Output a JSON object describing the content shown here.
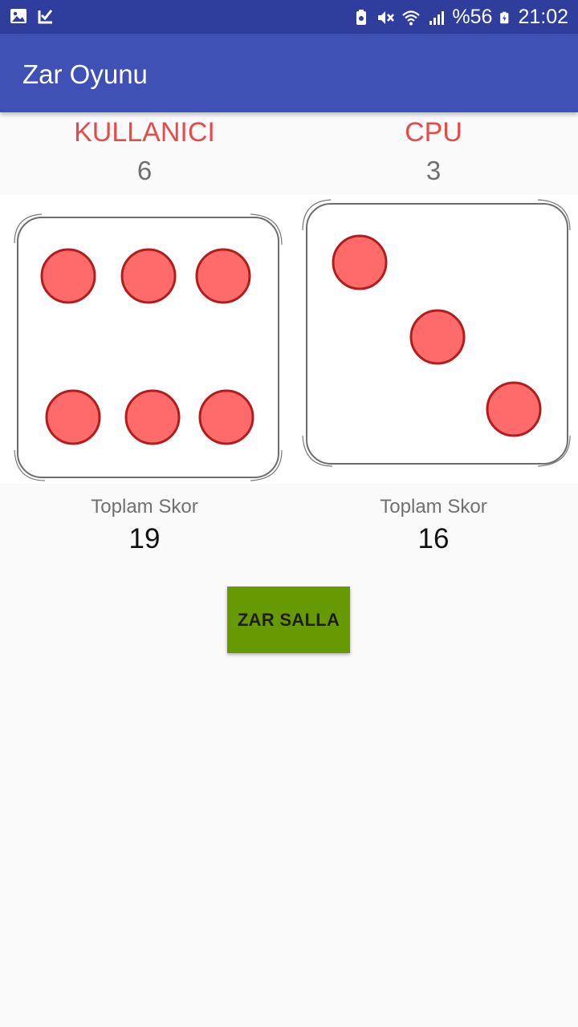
{
  "status_bar": {
    "battery_percent": "%56",
    "time": "21:02",
    "icons": [
      "image-icon",
      "check-download-icon",
      "battery-saver-icon",
      "mute-icon",
      "wifi-icon",
      "signal-icon",
      "battery-charging-icon"
    ]
  },
  "app_bar": {
    "title": "Zar Oyunu"
  },
  "players": [
    {
      "name": "KULLANICI",
      "roll": "6",
      "score_label": "Toplam Skor",
      "score": "19",
      "die_value": 6
    },
    {
      "name": "CPU",
      "roll": "3",
      "score_label": "Toplam Skor",
      "score": "16",
      "die_value": 3
    }
  ],
  "colors": {
    "status_bar": "#2f3d9c",
    "app_bar": "#3f51b5",
    "player_name": "#e84a4a",
    "pip_fill": "#ff6a6a",
    "pip_stroke": "#b01e1e",
    "button": "#669a00"
  },
  "roll_button": {
    "label": "ZAR SALLA"
  }
}
